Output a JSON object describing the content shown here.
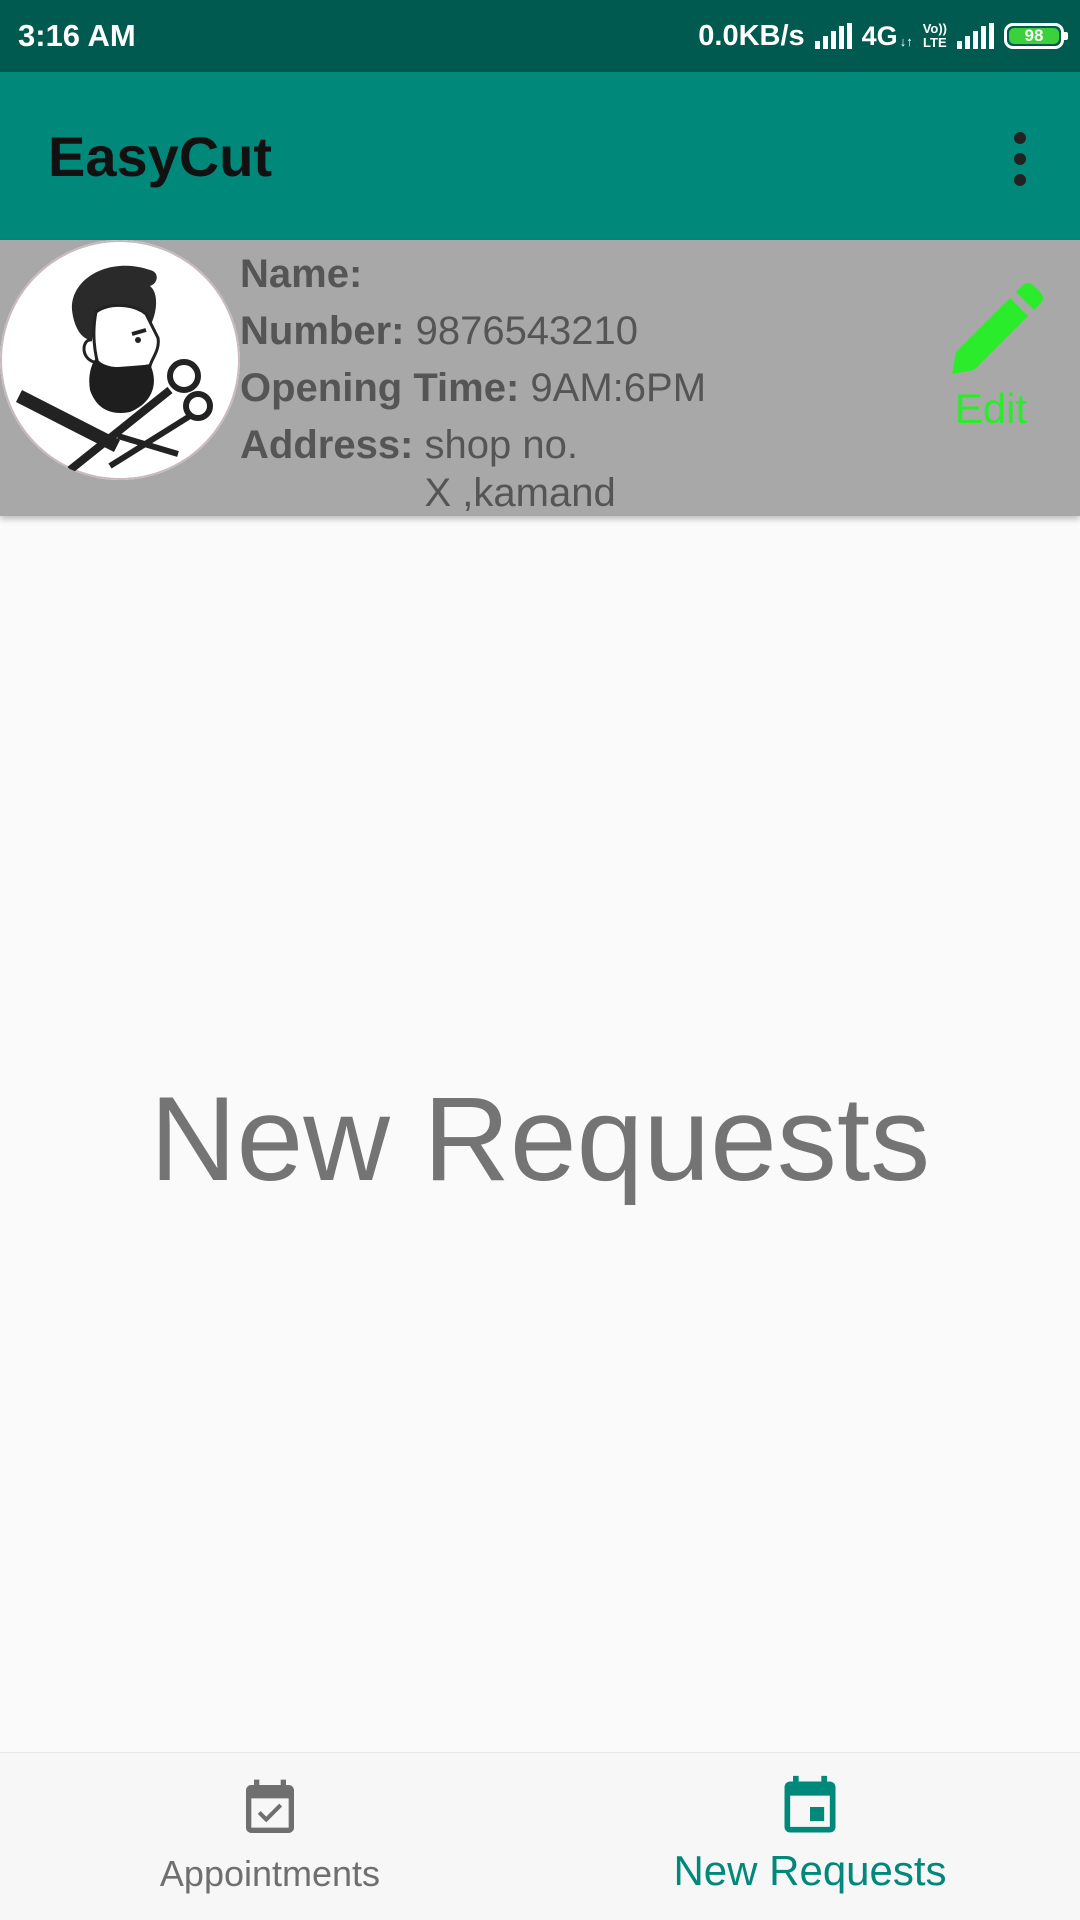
{
  "status_bar": {
    "time": "3:16 AM",
    "speed": "0.0KB/s",
    "network": "4G",
    "network_sub": "↓↑",
    "volte_top": "Vo))",
    "volte_bottom": "LTE",
    "battery": "98"
  },
  "app_bar": {
    "title": "EasyCut",
    "menu_icon": "more-vert-icon"
  },
  "profile": {
    "avatar_icon": "barber-logo",
    "name_label": "Name:",
    "name_value": "",
    "number_label": "Number:",
    "number_value": "9876543210",
    "opening_label": "Opening Time:",
    "opening_value": "9AM:6PM",
    "address_label": "Address:",
    "address_line1": "shop no.",
    "address_line2": "X ,kamand",
    "edit_label": "Edit",
    "edit_icon": "pencil-icon"
  },
  "main": {
    "title": "New Requests"
  },
  "bottom_nav": {
    "items": [
      {
        "label": "Appointments",
        "icon": "event-available-icon",
        "active": false
      },
      {
        "label": "New Requests",
        "icon": "event-icon",
        "active": true
      }
    ]
  },
  "colors": {
    "status_bar": "#005a4f",
    "primary": "#00897b",
    "card": "#a8a8a8",
    "edit_green": "#2bec2b",
    "center_text": "#747474"
  }
}
